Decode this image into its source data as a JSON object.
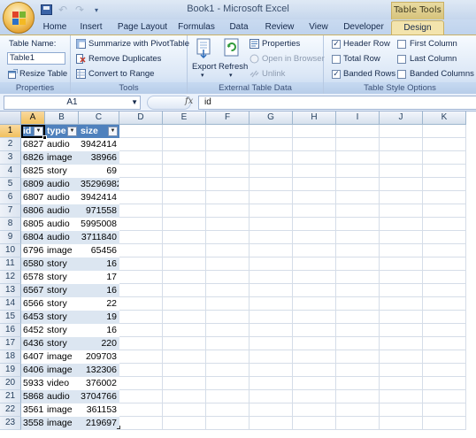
{
  "window": {
    "title": "Book1 - Microsoft Excel",
    "context_tab_group": "Table Tools"
  },
  "tabs": [
    "Home",
    "Insert",
    "Page Layout",
    "Formulas",
    "Data",
    "Review",
    "View",
    "Developer",
    "Design"
  ],
  "active_tab": "Design",
  "ribbon": {
    "properties": {
      "label": "Properties",
      "table_name_label": "Table Name:",
      "table_name_value": "Table1",
      "resize_table": "Resize Table"
    },
    "tools": {
      "label": "Tools",
      "summarize": "Summarize with PivotTable",
      "remove_duplicates": "Remove Duplicates",
      "convert_to_range": "Convert to Range"
    },
    "external": {
      "label": "External Table Data",
      "export": "Export",
      "refresh": "Refresh",
      "properties": "Properties",
      "open_in_browser": "Open in Browser",
      "unlink": "Unlink"
    },
    "style_options": {
      "label": "Table Style Options",
      "header_row": "Header Row",
      "total_row": "Total Row",
      "banded_rows": "Banded Rows",
      "first_column": "First Column",
      "last_column": "Last Column",
      "banded_columns": "Banded Columns",
      "checked": {
        "header_row": true,
        "total_row": false,
        "banded_rows": true,
        "first_column": false,
        "last_column": false,
        "banded_columns": false
      }
    }
  },
  "formula_bar": {
    "name_box": "A1",
    "fx": "fx",
    "formula": "id"
  },
  "grid": {
    "columns": [
      "A",
      "B",
      "C",
      "D",
      "E",
      "F",
      "G",
      "H",
      "I",
      "J",
      "K"
    ],
    "selected_column": "A",
    "selected_row": "1",
    "row_numbers": [
      "1",
      "2",
      "3",
      "4",
      "5",
      "6",
      "7",
      "8",
      "9",
      "10",
      "11",
      "12",
      "13",
      "14",
      "15",
      "16",
      "17",
      "18",
      "19",
      "20",
      "21",
      "22",
      "23"
    ],
    "table_headers": [
      "id",
      "type",
      "size"
    ],
    "table_rows": [
      [
        "6827",
        "audio",
        "3942414"
      ],
      [
        "6826",
        "image",
        "38966"
      ],
      [
        "6825",
        "story",
        "69"
      ],
      [
        "6809",
        "audio",
        "35296982"
      ],
      [
        "6807",
        "audio",
        "3942414"
      ],
      [
        "6806",
        "audio",
        "971558"
      ],
      [
        "6805",
        "audio",
        "5995008"
      ],
      [
        "6804",
        "audio",
        "3711840"
      ],
      [
        "6796",
        "image",
        "65456"
      ],
      [
        "6580",
        "story",
        "16"
      ],
      [
        "6578",
        "story",
        "17"
      ],
      [
        "6567",
        "story",
        "16"
      ],
      [
        "6566",
        "story",
        "22"
      ],
      [
        "6453",
        "story",
        "19"
      ],
      [
        "6452",
        "story",
        "16"
      ],
      [
        "6436",
        "story",
        "220"
      ],
      [
        "6407",
        "image",
        "209703"
      ],
      [
        "6406",
        "image",
        "132306"
      ],
      [
        "5933",
        "video",
        "376002"
      ],
      [
        "5868",
        "audio",
        "3704766"
      ],
      [
        "3561",
        "image",
        "361153"
      ],
      [
        "3558",
        "image",
        "219697"
      ]
    ]
  },
  "colors": {
    "table_header": "#4f81bd",
    "band": "#dce6f1",
    "selection_header": "#f1c15f",
    "ribbon_context": "#f3e4ad"
  }
}
